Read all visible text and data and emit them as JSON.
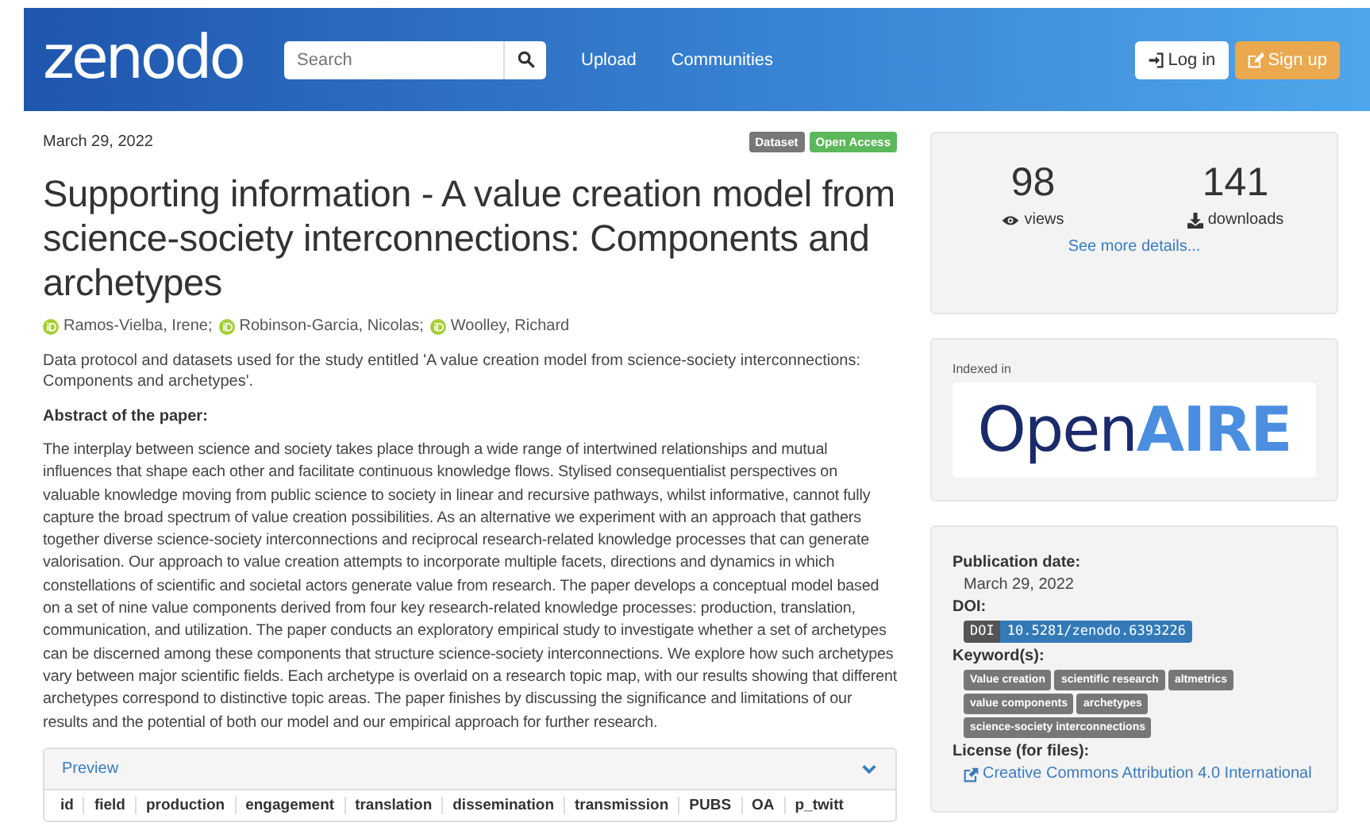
{
  "header": {
    "logo": "zenodo",
    "search": {
      "placeholder": "Search"
    },
    "nav": [
      "Upload",
      "Communities"
    ],
    "buttons": [
      {
        "label": "Log in",
        "kind": "login"
      },
      {
        "label": "Sign up",
        "kind": "signup"
      }
    ]
  },
  "record": {
    "date": "March 29, 2022",
    "badges": [
      {
        "label": "Dataset",
        "color": "#777777"
      },
      {
        "label": "Open Access",
        "color": "#5cb85c"
      }
    ],
    "title": "Supporting information - A value creation model from science-society interconnections: Components and archetypes",
    "authors": [
      "Ramos-Vielba, Irene;",
      "Robinson-Garcia, Nicolas;",
      "Woolley, Richard"
    ],
    "description": "Data protocol and datasets used for the study entitled 'A value creation model from science-society interconnections: Components and archetypes'.",
    "abstract_heading": "Abstract of the paper:",
    "abstract": "The interplay between science and society takes place through a wide range of intertwined relationships and mutual influences that shape each other and facilitate continuous knowledge flows. Stylised consequentialist perspectives on valuable knowledge moving from public science to society in linear and recursive pathways, whilst informative, cannot fully capture the broad spectrum of value creation possibilities. As an alternative we experiment with an approach that gathers together diverse science-society interconnections and reciprocal research-related knowledge processes that can generate valorisation. Our approach to value creation attempts to incorporate multiple facets, directions and dynamics in which constellations of scientific and societal actors generate value from research. The paper develops a conceptual model based on a set of nine value components derived from four key research-related knowledge processes: production, translation, communication, and utilization. The paper conducts an exploratory empirical study to investigate whether a set of archetypes can be discerned among these components that structure science-society interconnections. We explore how such archetypes vary between major scientific fields. Each archetype is overlaid on a research topic map, with our results showing that different archetypes correspond to distinctive topic areas. The paper finishes by discussing the significance and limitations of our results and the potential of both our model and our empirical approach for further research.",
    "preview": {
      "title": "Preview",
      "expanded": true,
      "columns": [
        "id",
        "field",
        "production",
        "engagement",
        "translation",
        "dissemination",
        "transmission",
        "PUBS",
        "OA",
        "p_twitt"
      ]
    }
  },
  "sidebar": {
    "stats": [
      {
        "value": "98",
        "label": "views",
        "kind": "views"
      },
      {
        "value": "141",
        "label": "downloads",
        "kind": "downloads"
      }
    ],
    "details_link": "See more details...",
    "indexed_label": "Indexed in",
    "indexed_logo": [
      {
        "text": "Open",
        "kind": "dark"
      },
      {
        "text": "AIRE",
        "kind": "accent"
      }
    ],
    "publication_date_label": "Publication date:",
    "publication_date": "March 29, 2022",
    "doi_label": "DOI:",
    "doi_tag": "DOI",
    "doi": "10.5281/zenodo.6393226",
    "keywords_label": "Keyword(s):",
    "keywords": [
      "Value creation",
      "scientific research",
      "altmetrics",
      "value components",
      "archetypes",
      "science-society interconnections"
    ],
    "license_label": "License (for files):",
    "license": "Creative Commons Attribution 4.0 International"
  }
}
